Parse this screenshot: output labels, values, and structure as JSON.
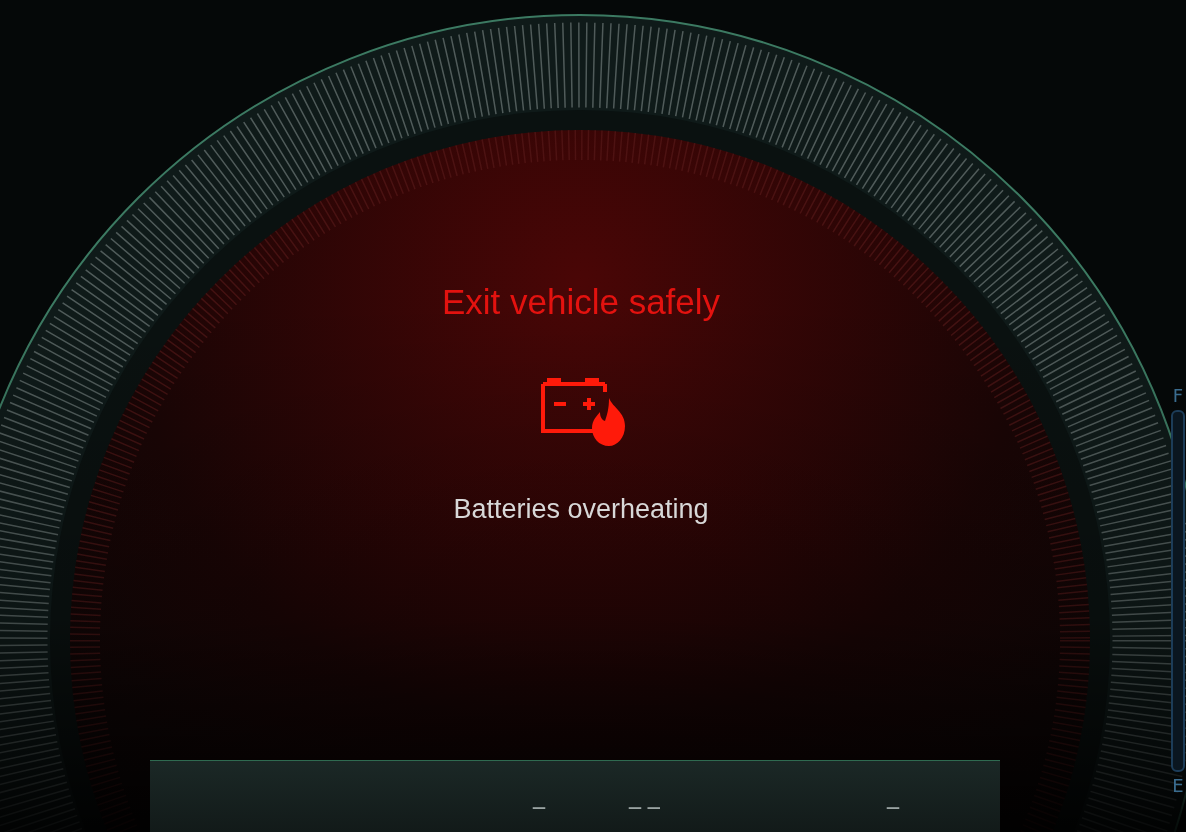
{
  "warning": {
    "title": "Exit vehicle safely",
    "message": "Batteries overheating"
  },
  "readouts": [
    "—",
    "— —",
    "—"
  ],
  "fuel_gauge": {
    "full_label": "F",
    "empty_label": "E"
  }
}
